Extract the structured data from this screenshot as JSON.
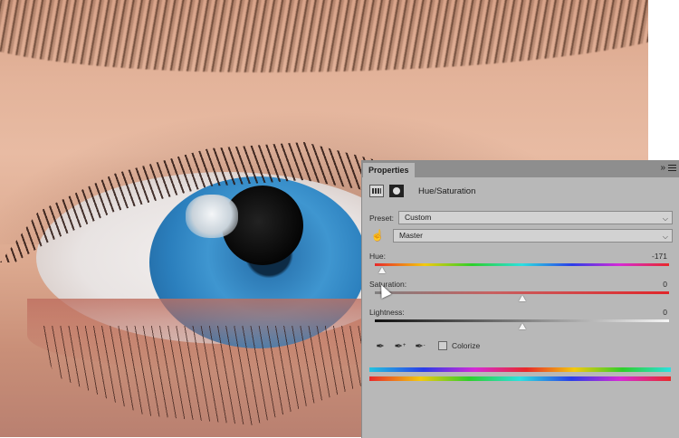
{
  "panel": {
    "tab_label": "Properties",
    "collapse_glyph": "»",
    "adjustment_title": "Hue/Saturation",
    "preset": {
      "label": "Preset:",
      "value": "Custom"
    },
    "channel": {
      "value": "Master"
    },
    "hue": {
      "label": "Hue:",
      "value": "-171",
      "level": -171,
      "min": -180,
      "max": 180
    },
    "saturation": {
      "label": "Saturation:",
      "value": "0",
      "level": 0,
      "min": -100,
      "max": 100
    },
    "lightness": {
      "label": "Lightness:",
      "value": "0",
      "level": 0,
      "min": -100,
      "max": 100
    },
    "colorize": {
      "label": "Colorize",
      "checked": false
    },
    "icons": [
      "adjustment-layer-icon",
      "layer-mask-icon",
      "target-adjust-hand-icon",
      "eyedropper-icon",
      "eyedropper-plus-icon",
      "eyedropper-minus-icon",
      "panel-menu-icon"
    ]
  }
}
